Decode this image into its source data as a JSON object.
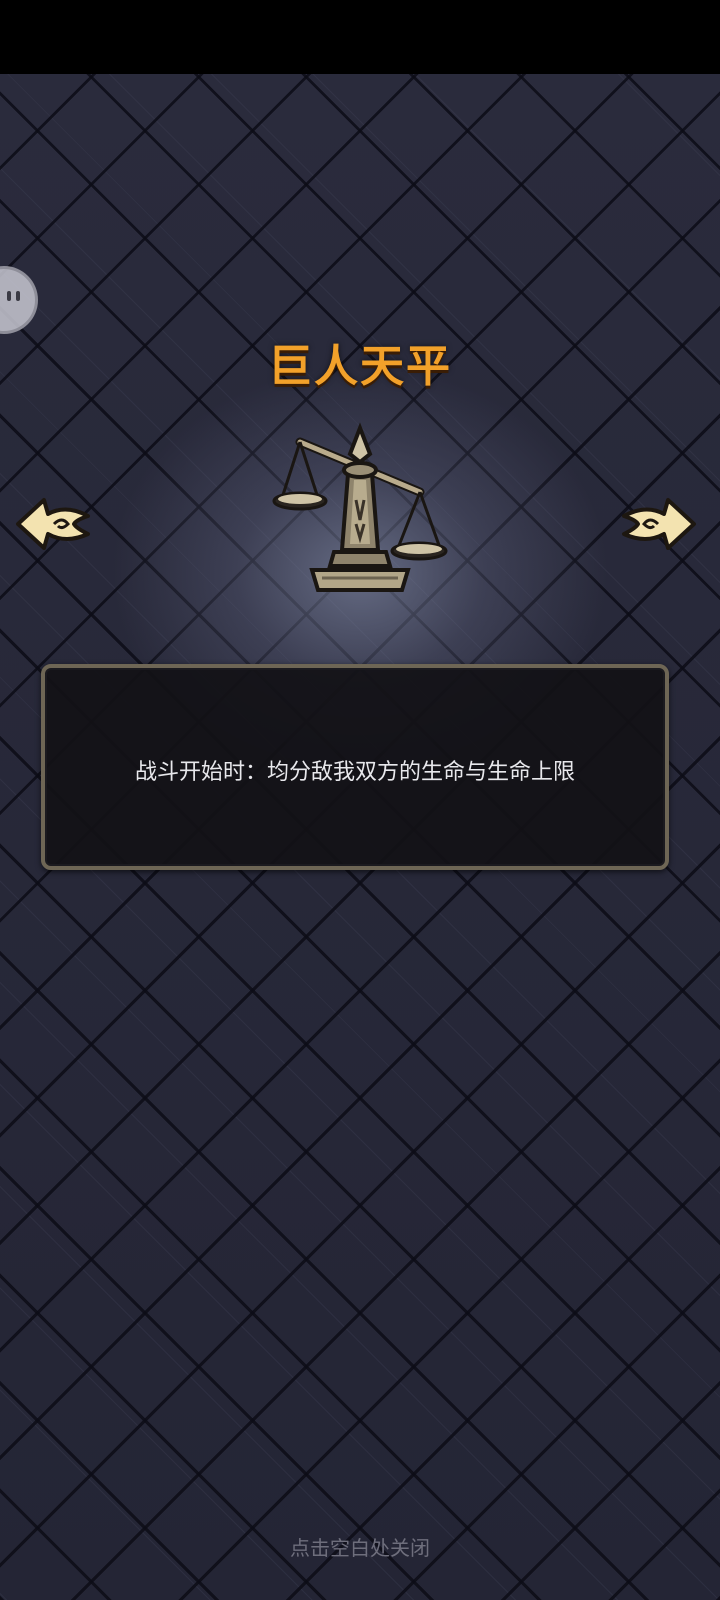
{
  "item": {
    "title": "巨人天平",
    "description": "战斗开始时：均分敌我双方的生命与生命上限",
    "image_icon": "balance-scale-icon"
  },
  "navigation": {
    "prev_icon": "left-arrow-icon",
    "next_icon": "right-arrow-icon"
  },
  "footer": {
    "close_hint": "点击空白处关闭"
  },
  "colors": {
    "title": "#f2a12a",
    "arrow_fill": "#f3e3b0",
    "background": "#272838",
    "panel_border": "#6e6655"
  }
}
